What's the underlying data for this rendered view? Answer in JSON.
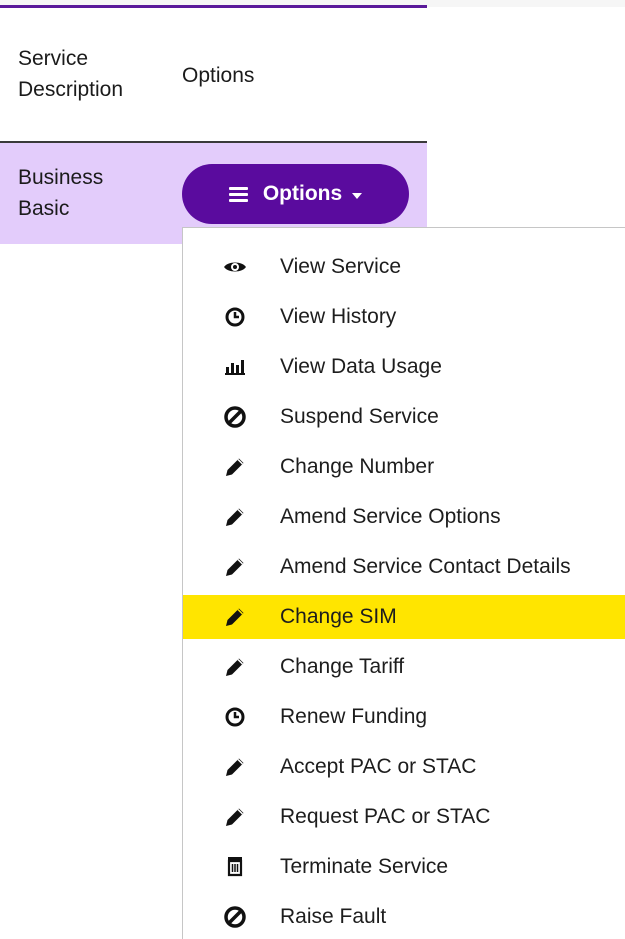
{
  "table": {
    "headers": {
      "description": "Service Description",
      "options": "Options"
    },
    "rows": [
      {
        "description": "Business Basic"
      }
    ]
  },
  "options_button": {
    "label": "Options",
    "icon": "hamburger-icon",
    "caret_icon": "caret-down-icon"
  },
  "menu": {
    "highlight_color": "#ffe500",
    "items": [
      {
        "label": "View Service",
        "icon": "eye-icon"
      },
      {
        "label": "View History",
        "icon": "clock-icon"
      },
      {
        "label": "View Data Usage",
        "icon": "bar-chart-icon"
      },
      {
        "label": "Suspend Service",
        "icon": "ban-icon"
      },
      {
        "label": "Change Number",
        "icon": "pencil-icon"
      },
      {
        "label": "Amend Service Options",
        "icon": "pencil-icon"
      },
      {
        "label": "Amend Service Contact Details",
        "icon": "pencil-icon"
      },
      {
        "label": "Change SIM",
        "icon": "pencil-icon",
        "highlighted": true
      },
      {
        "label": "Change Tariff",
        "icon": "pencil-icon"
      },
      {
        "label": "Renew Funding",
        "icon": "clock-icon"
      },
      {
        "label": "Accept PAC or STAC",
        "icon": "pencil-icon"
      },
      {
        "label": "Request PAC or STAC",
        "icon": "pencil-icon"
      },
      {
        "label": "Terminate Service",
        "icon": "trash-icon"
      },
      {
        "label": "Raise Fault",
        "icon": "ban-icon"
      }
    ]
  },
  "colors": {
    "accent": "#5a0b9e",
    "row_bg": "#e3ccfb",
    "text": "#1b1b1b"
  }
}
